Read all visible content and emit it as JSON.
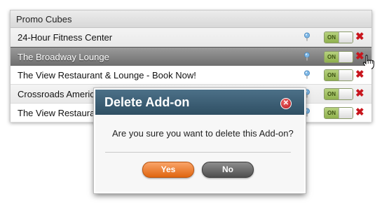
{
  "panel": {
    "title": "Promo Cubes",
    "rows": [
      {
        "label": "24-Hour Fitness Center",
        "toggle": "ON"
      },
      {
        "label": "The Broadway Lounge",
        "toggle": "ON",
        "selected": true
      },
      {
        "label": "The View Restaurant & Lounge - Book Now!",
        "toggle": "ON"
      },
      {
        "label": "Crossroads America",
        "toggle": "ON"
      },
      {
        "label": "The View Restauran",
        "toggle": "ON"
      }
    ]
  },
  "dialog": {
    "title": "Delete Add-on",
    "message": "Are you sure you want to delete this Add-on?",
    "yes_label": "Yes",
    "no_label": "No"
  },
  "icons": {
    "pin": "map-pin-icon",
    "delete": "delete-x-icon",
    "close": "close-icon",
    "cursor": "hand-pointer-icon"
  },
  "colors": {
    "dialog_header": "#2f4f63",
    "yes_button": "#e06610",
    "no_button": "#5a5a5a",
    "delete_red": "#c8161d",
    "toggle_on": "#8fb04d"
  }
}
